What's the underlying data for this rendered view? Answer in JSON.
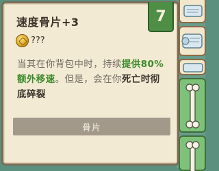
{
  "item": {
    "title": "速度骨片+3",
    "tier": "7",
    "cost": "???",
    "description": {
      "part1": "当其在你背包中时，持续",
      "part2": "提供80%额外移速",
      "part3": "。但是，会在你",
      "part4": "死亡时彻底碎裂"
    },
    "category_tag": "骨片"
  },
  "icons": [
    "coin-icon",
    "scroll-icon",
    "bone-icon"
  ],
  "colors": {
    "panel": "#f3ead4",
    "tier_badge": "#4e8f45",
    "highlight": "#3c8a2a",
    "tag": "#a3998a"
  }
}
